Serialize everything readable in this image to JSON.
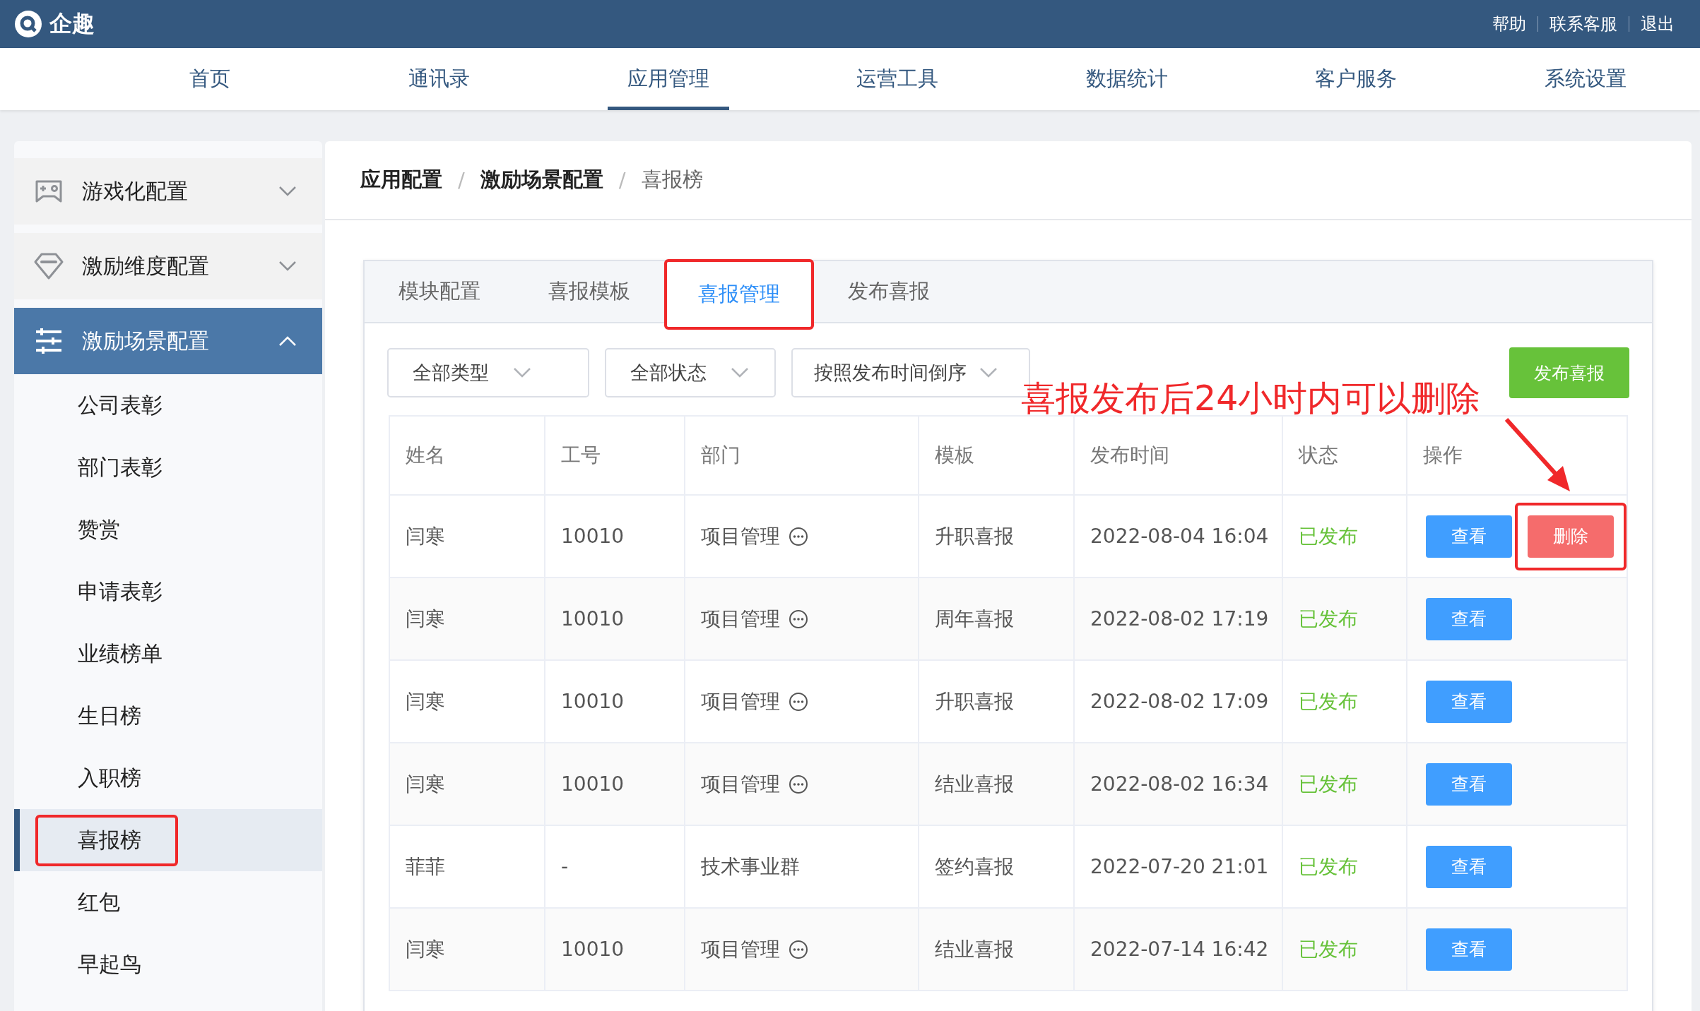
{
  "brand": {
    "name": "企趣"
  },
  "top_links": [
    "帮助",
    "联系客服",
    "退出"
  ],
  "nav": [
    {
      "label": "首页",
      "selected": false
    },
    {
      "label": "通讯录",
      "selected": false
    },
    {
      "label": "应用管理",
      "selected": true
    },
    {
      "label": "运营工具",
      "selected": false
    },
    {
      "label": "数据统计",
      "selected": false
    },
    {
      "label": "客户服务",
      "selected": false
    },
    {
      "label": "系统设置",
      "selected": false
    }
  ],
  "sidebar": [
    {
      "kind": "gamepad",
      "label": "游戏化配置",
      "expanded": false,
      "selected": false
    },
    {
      "kind": "diamond",
      "label": "激励维度配置",
      "expanded": false,
      "selected": false
    },
    {
      "kind": "sliders",
      "label": "激励场景配置",
      "expanded": true,
      "selected": true,
      "children": [
        {
          "label": "公司表彰",
          "selected": false,
          "highlighted": false
        },
        {
          "label": "部门表彰",
          "selected": false,
          "highlighted": false
        },
        {
          "label": "赞赏",
          "selected": false,
          "highlighted": false
        },
        {
          "label": "申请表彰",
          "selected": false,
          "highlighted": false
        },
        {
          "label": "业绩榜单",
          "selected": false,
          "highlighted": false
        },
        {
          "label": "生日榜",
          "selected": false,
          "highlighted": false
        },
        {
          "label": "入职榜",
          "selected": false,
          "highlighted": false
        },
        {
          "label": "喜报榜",
          "selected": true,
          "highlighted": true
        },
        {
          "label": "红包",
          "selected": false,
          "highlighted": false
        },
        {
          "label": "早起鸟",
          "selected": false,
          "highlighted": false
        }
      ]
    }
  ],
  "breadcrumb": [
    {
      "kind": "link",
      "text": "应用配置"
    },
    {
      "kind": "separator",
      "text": "/"
    },
    {
      "kind": "link",
      "text": "激励场景配置"
    },
    {
      "kind": "separator",
      "text": "/"
    },
    {
      "kind": "current",
      "text": "喜报榜"
    }
  ],
  "tabs": [
    {
      "label": "模块配置",
      "selected": false,
      "highlighted": false
    },
    {
      "label": "喜报模板",
      "selected": false,
      "highlighted": false
    },
    {
      "label": "喜报管理",
      "selected": true,
      "highlighted": true
    },
    {
      "label": "发布喜报",
      "selected": false,
      "highlighted": false
    }
  ],
  "filters": [
    "全部类型",
    "全部状态",
    "按照发布时间倒序"
  ],
  "publish_button": "发布喜报",
  "annotation": "喜报发布后24小时内可以删除",
  "table": {
    "columns": [
      "姓名",
      "工号",
      "部门",
      "模板",
      "发布时间",
      "状态",
      "操作"
    ],
    "rows": [
      {
        "name": "闫寒",
        "id": "10010",
        "dept": "项目管理",
        "dept_more": true,
        "template": "升职喜报",
        "time": "2022-08-04 16:04",
        "status": "已发布",
        "actions": [
          {
            "label": "查看",
            "kind": "view",
            "highlighted": false
          },
          {
            "label": "删除",
            "kind": "delete",
            "highlighted": true
          }
        ]
      },
      {
        "name": "闫寒",
        "id": "10010",
        "dept": "项目管理",
        "dept_more": true,
        "template": "周年喜报",
        "time": "2022-08-02 17:19",
        "status": "已发布",
        "actions": [
          {
            "label": "查看",
            "kind": "view",
            "highlighted": false
          }
        ]
      },
      {
        "name": "闫寒",
        "id": "10010",
        "dept": "项目管理",
        "dept_more": true,
        "template": "升职喜报",
        "time": "2022-08-02 17:09",
        "status": "已发布",
        "actions": [
          {
            "label": "查看",
            "kind": "view",
            "highlighted": false
          }
        ]
      },
      {
        "name": "闫寒",
        "id": "10010",
        "dept": "项目管理",
        "dept_more": true,
        "template": "结业喜报",
        "time": "2022-08-02 16:34",
        "status": "已发布",
        "actions": [
          {
            "label": "查看",
            "kind": "view",
            "highlighted": false
          }
        ]
      },
      {
        "name": "菲菲",
        "id": "-",
        "dept": "技术事业群",
        "dept_more": false,
        "template": "签约喜报",
        "time": "2022-07-20 21:01",
        "status": "已发布",
        "actions": [
          {
            "label": "查看",
            "kind": "view",
            "highlighted": false
          }
        ]
      },
      {
        "name": "闫寒",
        "id": "10010",
        "dept": "项目管理",
        "dept_more": true,
        "template": "结业喜报",
        "time": "2022-07-14 16:42",
        "status": "已发布",
        "actions": [
          {
            "label": "查看",
            "kind": "view",
            "highlighted": false
          }
        ]
      }
    ]
  }
}
